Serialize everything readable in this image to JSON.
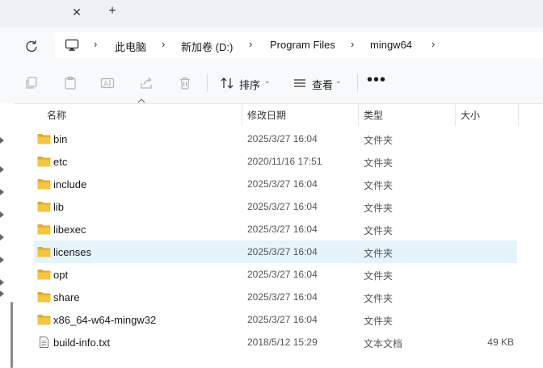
{
  "tabbar": {
    "close_glyph": "✕",
    "add_glyph": "+"
  },
  "address": {
    "segments": [
      "此电脑",
      "新加卷 (D:)",
      "Program Files",
      "mingw64"
    ]
  },
  "toolbar": {
    "sort_label": "排序",
    "view_label": "查看",
    "more_glyph": "•••"
  },
  "columns": {
    "name": "名称",
    "date": "修改日期",
    "type": "类型",
    "size": "大小"
  },
  "files": [
    {
      "name": "bin",
      "date": "2025/3/27 16:04",
      "type": "文件夹",
      "size": "",
      "kind": "folder"
    },
    {
      "name": "etc",
      "date": "2020/11/16 17:51",
      "type": "文件夹",
      "size": "",
      "kind": "folder"
    },
    {
      "name": "include",
      "date": "2025/3/27 16:04",
      "type": "文件夹",
      "size": "",
      "kind": "folder"
    },
    {
      "name": "lib",
      "date": "2025/3/27 16:04",
      "type": "文件夹",
      "size": "",
      "kind": "folder"
    },
    {
      "name": "libexec",
      "date": "2025/3/27 16:04",
      "type": "文件夹",
      "size": "",
      "kind": "folder"
    },
    {
      "name": "licenses",
      "date": "2025/3/27 16:04",
      "type": "文件夹",
      "size": "",
      "kind": "folder",
      "selected": true
    },
    {
      "name": "opt",
      "date": "2025/3/27 16:04",
      "type": "文件夹",
      "size": "",
      "kind": "folder"
    },
    {
      "name": "share",
      "date": "2025/3/27 16:04",
      "type": "文件夹",
      "size": "",
      "kind": "folder"
    },
    {
      "name": "x86_64-w64-mingw32",
      "date": "2025/3/27 16:04",
      "type": "文件夹",
      "size": "",
      "kind": "folder"
    },
    {
      "name": "build-info.txt",
      "date": "2018/5/12 15:29",
      "type": "文本文档",
      "size": "49 KB",
      "kind": "text-file"
    }
  ],
  "colors": {
    "folder": "#f4c542",
    "folder_dark": "#e0a92a",
    "selection": "#e5f3fb"
  }
}
